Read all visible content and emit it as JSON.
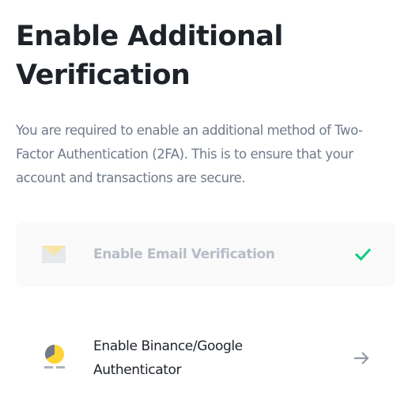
{
  "header": {
    "title": "Enable Additional Verification"
  },
  "description": "You are required to enable an additional method of Two-Factor Authentication (2FA). This is to ensure that your account and transactions are secure.",
  "options": [
    {
      "label": "Enable Email Verification",
      "icon": "email-envelope-icon",
      "status_icon": "checkmark-icon",
      "state": "completed",
      "status_color": "#0ecb81"
    },
    {
      "label": "Enable Binance/Google Authenticator",
      "icon": "authenticator-icon",
      "status_icon": "arrow-right-icon",
      "state": "pending",
      "status_color": "#929aa5"
    }
  ],
  "colors": {
    "title": "#1e2329",
    "description": "#707a8a",
    "disabled_text": "#b7bdc6",
    "accent_yellow": "#f0b90b",
    "success_green": "#0ecb81"
  }
}
